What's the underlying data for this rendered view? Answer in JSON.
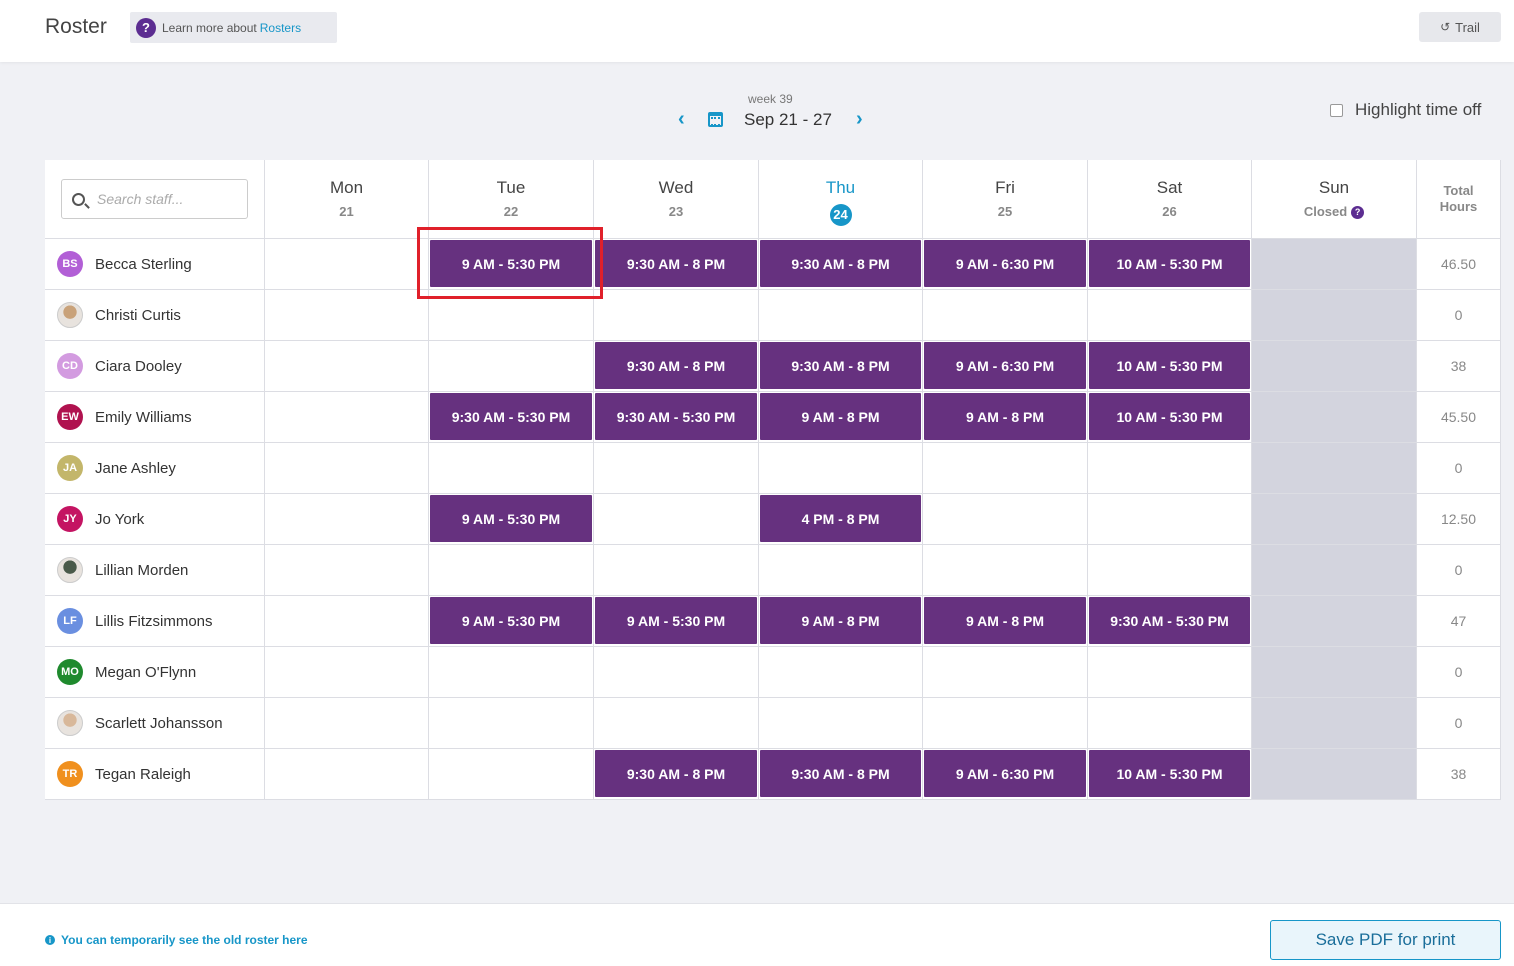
{
  "header": {
    "title": "Roster",
    "learn_prefix": "Learn more about",
    "learn_link": "Rosters",
    "trail_label": "Trail"
  },
  "week": {
    "label": "week 39",
    "range": "Sep 21 - 27"
  },
  "highlight_time_off": "Highlight time off",
  "search": {
    "placeholder": "Search staff..."
  },
  "days": [
    {
      "name": "Mon",
      "date": "21"
    },
    {
      "name": "Tue",
      "date": "22"
    },
    {
      "name": "Wed",
      "date": "23"
    },
    {
      "name": "Thu",
      "date": "24"
    },
    {
      "name": "Fri",
      "date": "25"
    },
    {
      "name": "Sat",
      "date": "26"
    },
    {
      "name": "Sun",
      "date": "Closed"
    }
  ],
  "total_hours_label": "Total Hours",
  "staff": [
    {
      "name": "Becca Sterling",
      "initials": "BS",
      "color": "#b25fd6",
      "photo": false,
      "shifts": [
        "",
        "9 AM - 5:30 PM",
        "9:30 AM - 8 PM",
        "9:30 AM - 8 PM",
        "9 AM - 6:30 PM",
        "10 AM - 5:30 PM"
      ],
      "total": "46.50"
    },
    {
      "name": "Christi Curtis",
      "initials": "",
      "color": "#c9a27a",
      "photo": true,
      "shifts": [
        "",
        "",
        "",
        "",
        "",
        ""
      ],
      "total": "0"
    },
    {
      "name": "Ciara Dooley",
      "initials": "CD",
      "color": "#d39be0",
      "photo": false,
      "shifts": [
        "",
        "",
        "9:30 AM - 8 PM",
        "9:30 AM - 8 PM",
        "9 AM - 6:30 PM",
        "10 AM - 5:30 PM"
      ],
      "total": "38"
    },
    {
      "name": "Emily Williams",
      "initials": "EW",
      "color": "#b0124f",
      "photo": false,
      "shifts": [
        "",
        "9:30 AM - 5:30 PM",
        "9:30 AM - 5:30 PM",
        "9 AM - 8 PM",
        "9 AM - 8 PM",
        "10 AM - 5:30 PM"
      ],
      "total": "45.50"
    },
    {
      "name": "Jane Ashley",
      "initials": "JA",
      "color": "#c3b66a",
      "photo": false,
      "shifts": [
        "",
        "",
        "",
        "",
        "",
        ""
      ],
      "total": "0"
    },
    {
      "name": "Jo York",
      "initials": "JY",
      "color": "#c41462",
      "photo": false,
      "shifts": [
        "",
        "9 AM - 5:30 PM",
        "",
        "4 PM - 8 PM",
        "",
        ""
      ],
      "total": "12.50"
    },
    {
      "name": "Lillian Morden",
      "initials": "",
      "color": "#4a5a4a",
      "photo": true,
      "shifts": [
        "",
        "",
        "",
        "",
        "",
        ""
      ],
      "total": "0"
    },
    {
      "name": "Lillis Fitzsimmons",
      "initials": "LF",
      "color": "#6a8fe0",
      "photo": false,
      "shifts": [
        "",
        "9 AM - 5:30 PM",
        "9 AM - 5:30 PM",
        "9 AM - 8 PM",
        "9 AM - 8 PM",
        "9:30 AM - 5:30 PM"
      ],
      "total": "47"
    },
    {
      "name": "Megan O'Flynn",
      "initials": "MO",
      "color": "#1f8a2e",
      "photo": false,
      "shifts": [
        "",
        "",
        "",
        "",
        "",
        ""
      ],
      "total": "0"
    },
    {
      "name": "Scarlett Johansson",
      "initials": "",
      "color": "#d8b89a",
      "photo": true,
      "shifts": [
        "",
        "",
        "",
        "",
        "",
        ""
      ],
      "total": "0"
    },
    {
      "name": "Tegan Raleigh",
      "initials": "TR",
      "color": "#f0901e",
      "photo": false,
      "shifts": [
        "",
        "",
        "9:30 AM - 8 PM",
        "9:30 AM - 8 PM",
        "9 AM - 6:30 PM",
        "10 AM - 5:30 PM"
      ],
      "total": "38"
    }
  ],
  "footer": {
    "note": "You can temporarily see the old roster here",
    "pdf_button": "Save PDF for print"
  },
  "colors": {
    "accent": "#1796c8",
    "shift": "#66317f",
    "brand": "#5c2d91",
    "closed_day": "#d3d4de",
    "highlight": "#e0202a"
  }
}
